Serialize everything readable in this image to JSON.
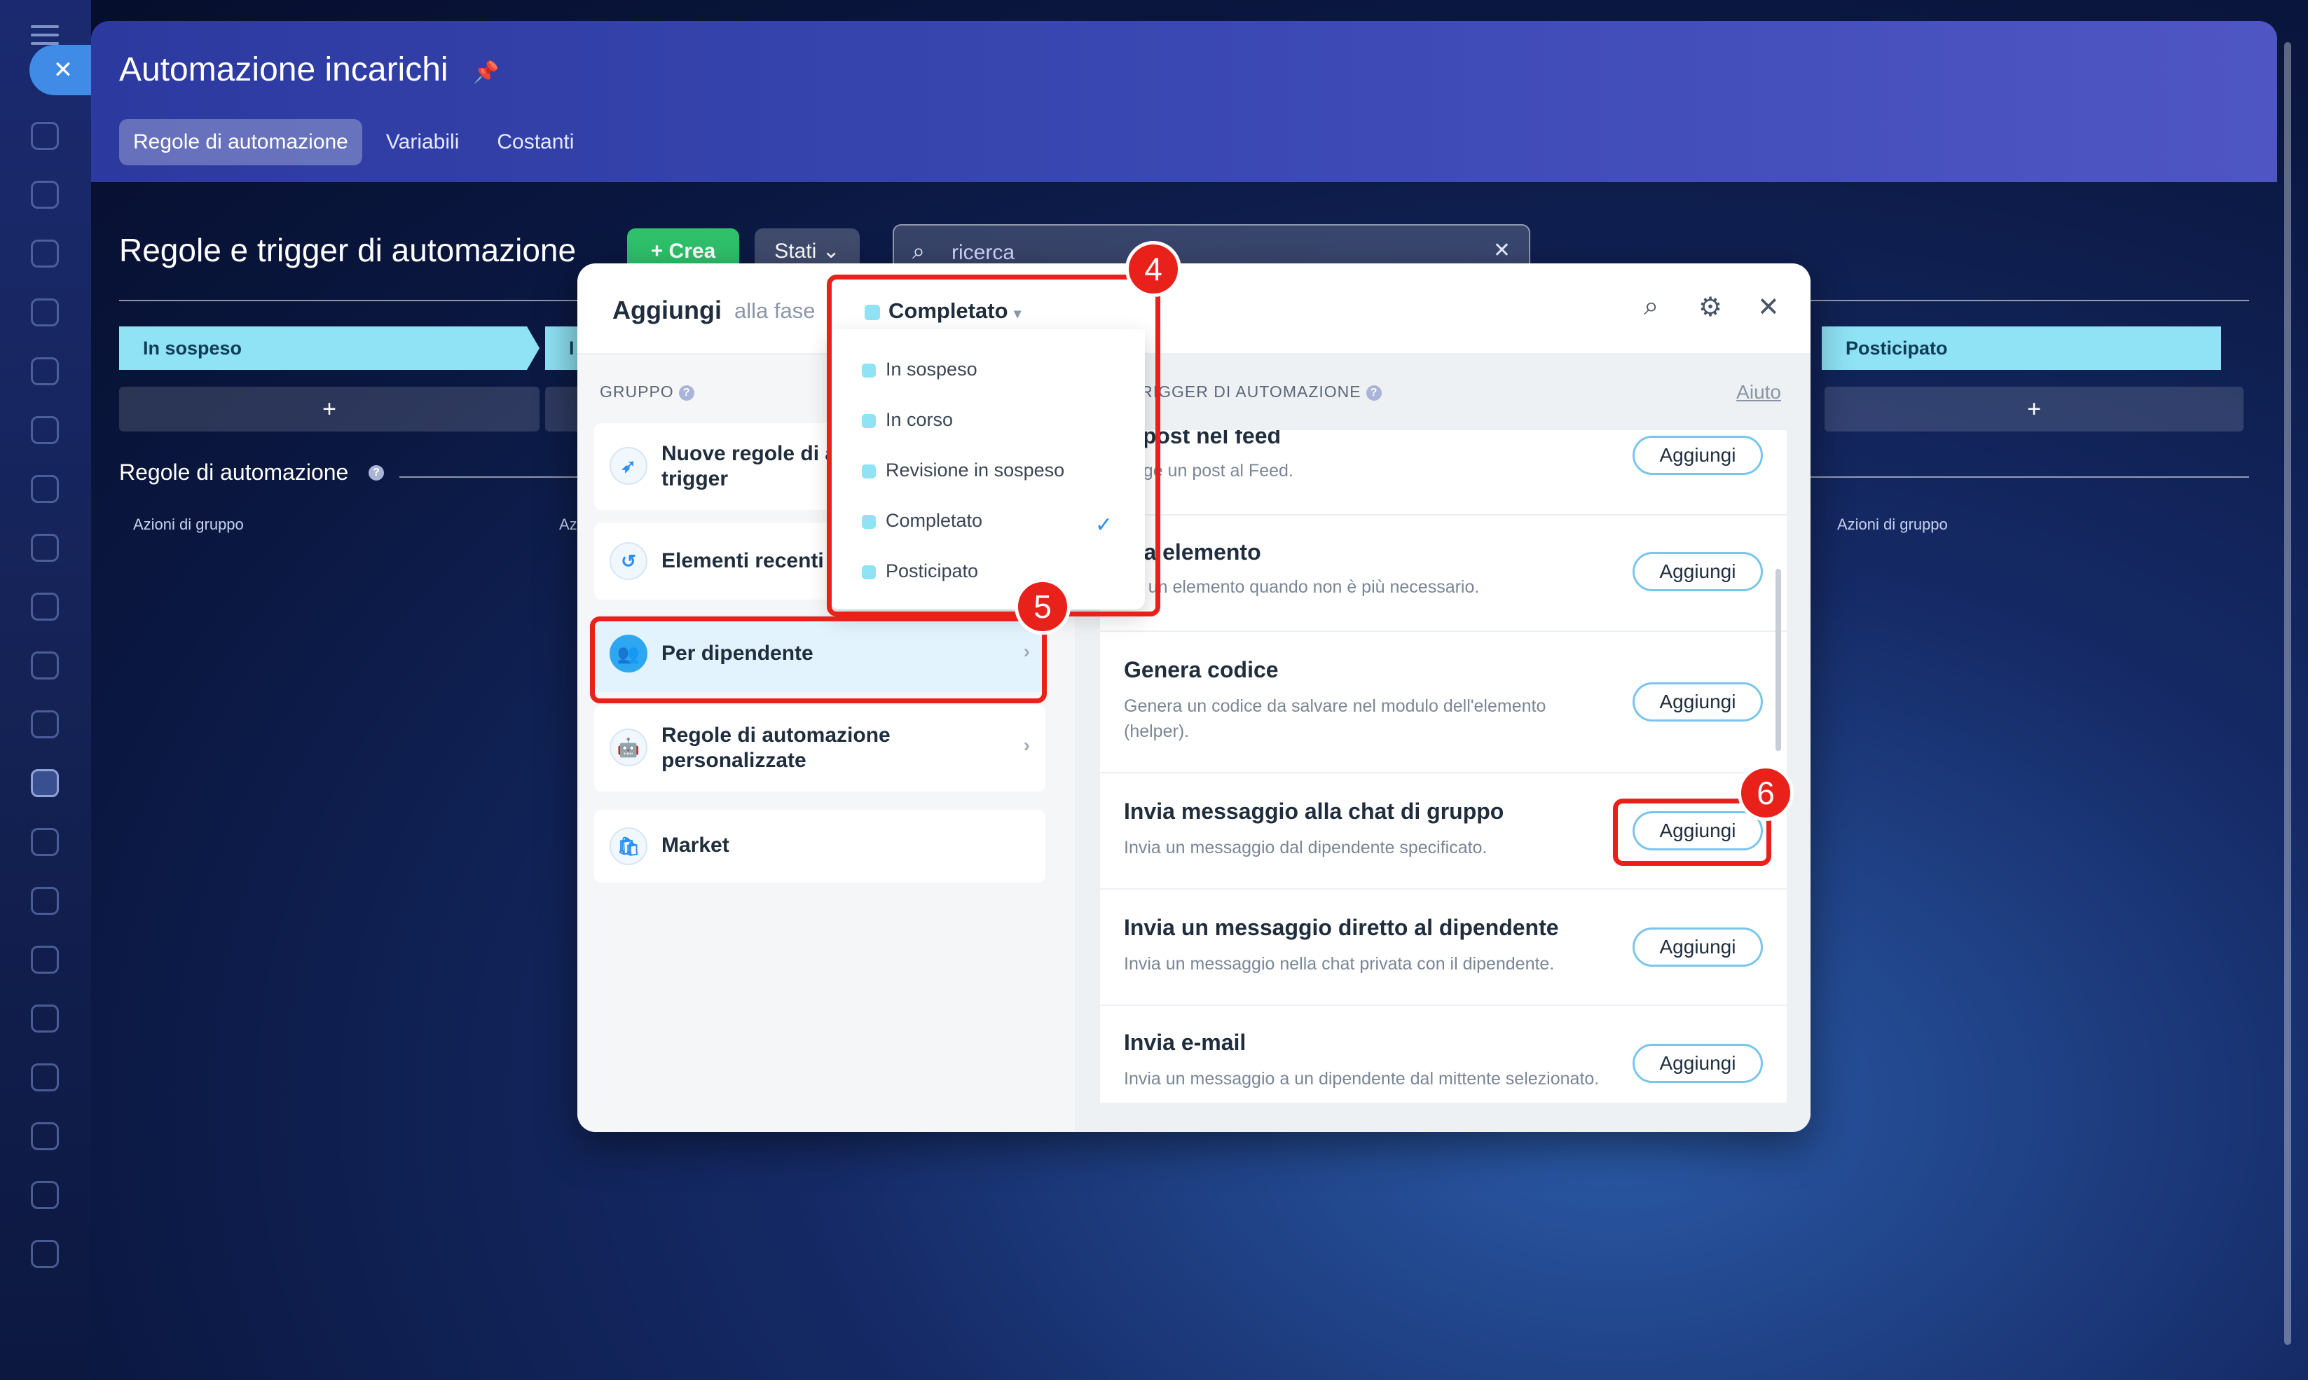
{
  "app": {
    "title": "Automazione incarichi",
    "tabs": [
      "Regole di automazione",
      "Variabili",
      "Costanti"
    ]
  },
  "page": {
    "section_title": "Regole e trigger di automazione",
    "create_label": "+ Crea",
    "states_label": "Stati",
    "search_placeholder": "ricerca",
    "stages_visible": [
      "In sospeso",
      "I",
      "Posticipato"
    ],
    "add_symbol": "+",
    "automation_rules_title": "Regole di automazione",
    "group_actions_label": "Azioni di gruppo",
    "group_actions_partial": "Az"
  },
  "modal": {
    "title": "Aggiungi",
    "subtitle": "alla fase",
    "selected_stage": "Completato",
    "group_header": "GRUPPO",
    "right_header": "E E TRIGGER DI AUTOMAZIONE",
    "help_link": "Aiuto",
    "groups": [
      {
        "label_line1": "Nuove regole di a",
        "label_line2": "trigger"
      },
      {
        "label_line1": "Elementi recenti",
        "label_line2": ""
      },
      {
        "label_line1": "Per dipendente",
        "label_line2": ""
      },
      {
        "label_line1": "Regole di automazione",
        "label_line2": "personalizzate"
      },
      {
        "label_line1": "Market",
        "label_line2": ""
      }
    ],
    "items": [
      {
        "title": "a post nel feed",
        "desc": "unge un post al Feed."
      },
      {
        "title": "ina elemento",
        "desc": "na un elemento quando non è più necessario."
      },
      {
        "title": "Genera codice",
        "desc": "Genera un codice da salvare nel modulo dell'elemento (helper)."
      },
      {
        "title": "Invia messaggio alla chat di gruppo",
        "desc": "Invia un messaggio dal dipendente specificato."
      },
      {
        "title": "Invia un messaggio diretto al dipendente",
        "desc": "Invia un messaggio nella chat privata con il dipendente."
      },
      {
        "title": "Invia e-mail",
        "desc": "Invia un messaggio a un dipendente dal mittente selezionato."
      }
    ],
    "add_button_label": "Aggiungi"
  },
  "dropdown": {
    "options": [
      "In sospeso",
      "In corso",
      "Revisione in sospeso",
      "Completato",
      "Posticipato"
    ],
    "selected": "Completato"
  },
  "annotations": [
    "4",
    "5",
    "6"
  ],
  "colors": {
    "accent": "#2b8ef0",
    "stage": "#8fe3f5",
    "create": "#2fc26b",
    "annotation": "#e8211b"
  }
}
